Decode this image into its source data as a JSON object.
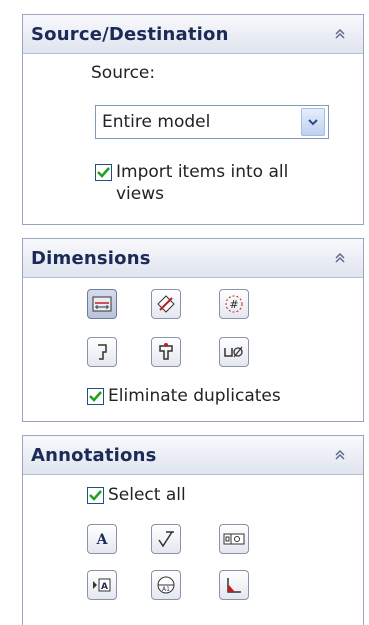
{
  "source_destination": {
    "title": "Source/Destination",
    "source_label": "Source:",
    "source_value": "Entire model",
    "import_label": "Import items into all",
    "import_label_line2": "views",
    "import_checked": true
  },
  "dimensions": {
    "title": "Dimensions",
    "buttons": [
      {
        "icon": "marked-for-drawing-icon"
      },
      {
        "icon": "not-marked-for-drawing-icon"
      },
      {
        "icon": "instance-count-icon"
      },
      {
        "icon": "tolerance-dimension-icon"
      },
      {
        "icon": "hole-wizard-profile-icon"
      },
      {
        "icon": "hole-callout-icon"
      }
    ],
    "eliminate_label": "Eliminate duplicates",
    "eliminate_checked": true
  },
  "annotations": {
    "title": "Annotations",
    "select_all_label": "Select all",
    "select_all_checked": true,
    "buttons": [
      {
        "icon": "note-icon"
      },
      {
        "icon": "surface-finish-icon"
      },
      {
        "icon": "geometric-tolerance-icon"
      },
      {
        "icon": "datum-feature-icon"
      },
      {
        "icon": "datum-target-icon"
      },
      {
        "icon": "weld-symbol-icon"
      }
    ]
  },
  "colors": {
    "header_text": "#1b2a57",
    "check": "#22a022",
    "border": "#9aa6bd"
  }
}
